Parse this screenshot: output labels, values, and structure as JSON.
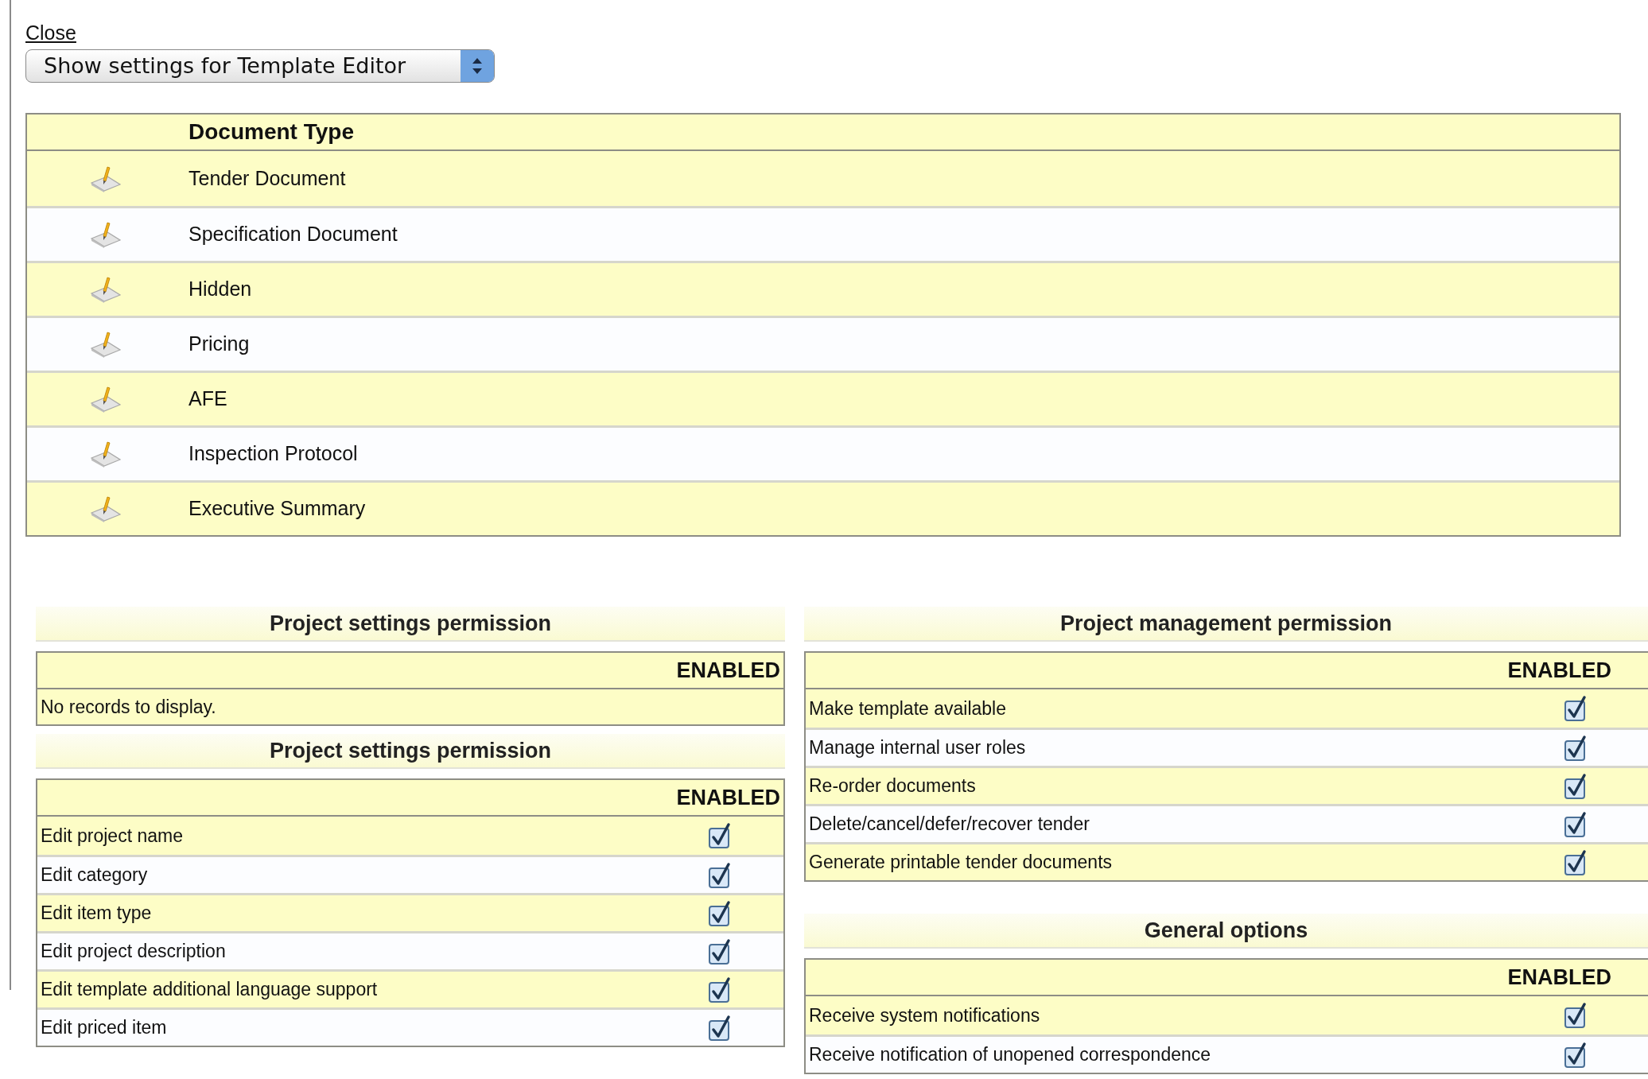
{
  "close_link": "Close",
  "settings_select": {
    "value": "Show settings for Template Editor"
  },
  "document_table": {
    "column": "Document Type",
    "rows": [
      {
        "name": "Tender Document"
      },
      {
        "name": "Specification Document"
      },
      {
        "name": "Hidden"
      },
      {
        "name": "Pricing"
      },
      {
        "name": "AFE"
      },
      {
        "name": "Inspection Protocol"
      },
      {
        "name": "Executive Summary"
      }
    ]
  },
  "left_sections": [
    {
      "title": "Project settings permission",
      "column": "ENABLED",
      "empty_message": "No records to display."
    },
    {
      "title": "Project settings permission",
      "column": "ENABLED",
      "rows": [
        {
          "label": "Edit project name",
          "checked": true
        },
        {
          "label": "Edit category",
          "checked": true
        },
        {
          "label": "Edit item type",
          "checked": true
        },
        {
          "label": "Edit project description",
          "checked": true
        },
        {
          "label": "Edit template additional language support",
          "checked": true
        },
        {
          "label": "Edit priced item",
          "checked": true
        }
      ]
    }
  ],
  "right_sections": [
    {
      "title": "Project management permission",
      "column": "ENABLED",
      "rows": [
        {
          "label": "Make template available",
          "checked": true
        },
        {
          "label": "Manage internal user roles",
          "checked": true
        },
        {
          "label": "Re-order documents",
          "checked": true
        },
        {
          "label": "Delete/cancel/defer/recover tender",
          "checked": true
        },
        {
          "label": "Generate printable tender documents",
          "checked": true
        }
      ]
    },
    {
      "title": "General options",
      "column": "ENABLED",
      "rows": [
        {
          "label": "Receive system notifications",
          "checked": true
        },
        {
          "label": "Receive notification of unopened correspondence",
          "checked": true
        }
      ]
    }
  ]
}
